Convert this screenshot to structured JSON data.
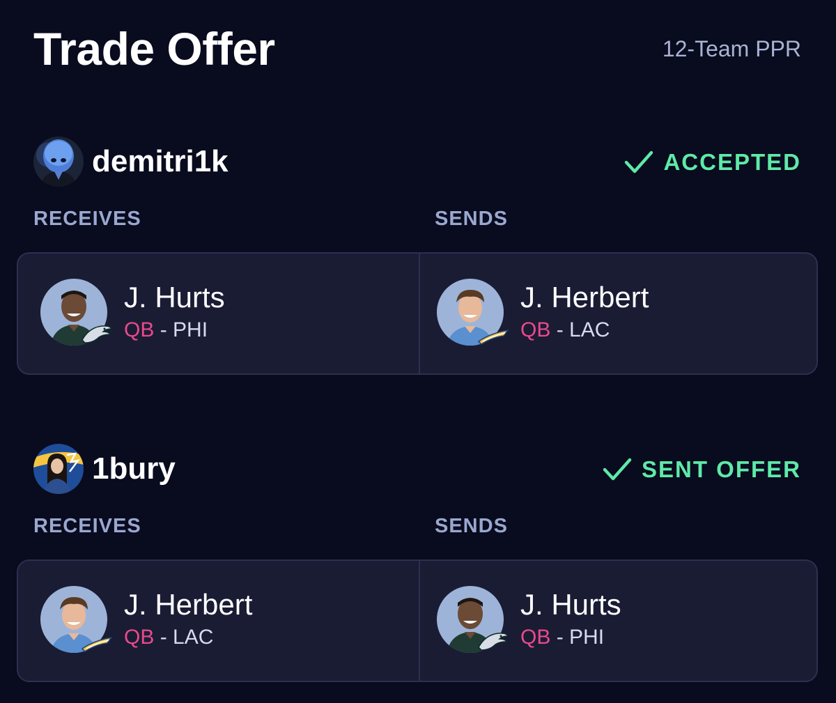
{
  "header": {
    "title": "Trade Offer",
    "league": "12-Team PPR"
  },
  "teams": [
    {
      "name": "demitri1k",
      "status": "ACCEPTED",
      "receives_label": "RECEIVES",
      "sends_label": "SENDS",
      "receives": {
        "name": "J. Hurts",
        "position": "QB",
        "team": "- PHI"
      },
      "sends": {
        "name": "J. Herbert",
        "position": "QB",
        "team": "- LAC"
      }
    },
    {
      "name": "1bury",
      "status": "SENT OFFER",
      "receives_label": "RECEIVES",
      "sends_label": "SENDS",
      "receives": {
        "name": "J. Herbert",
        "position": "QB",
        "team": "- LAC"
      },
      "sends": {
        "name": "J. Hurts",
        "position": "QB",
        "team": "- PHI"
      }
    }
  ],
  "colors": {
    "background": "#090b1e",
    "card": "#1a1c34",
    "status": "#5eeaa8",
    "position": "#e94a8c",
    "label": "#9aa8d0"
  },
  "icons": {
    "status": "check-icon",
    "eagles": "eagles-logo-icon",
    "chargers": "chargers-logo-icon"
  }
}
